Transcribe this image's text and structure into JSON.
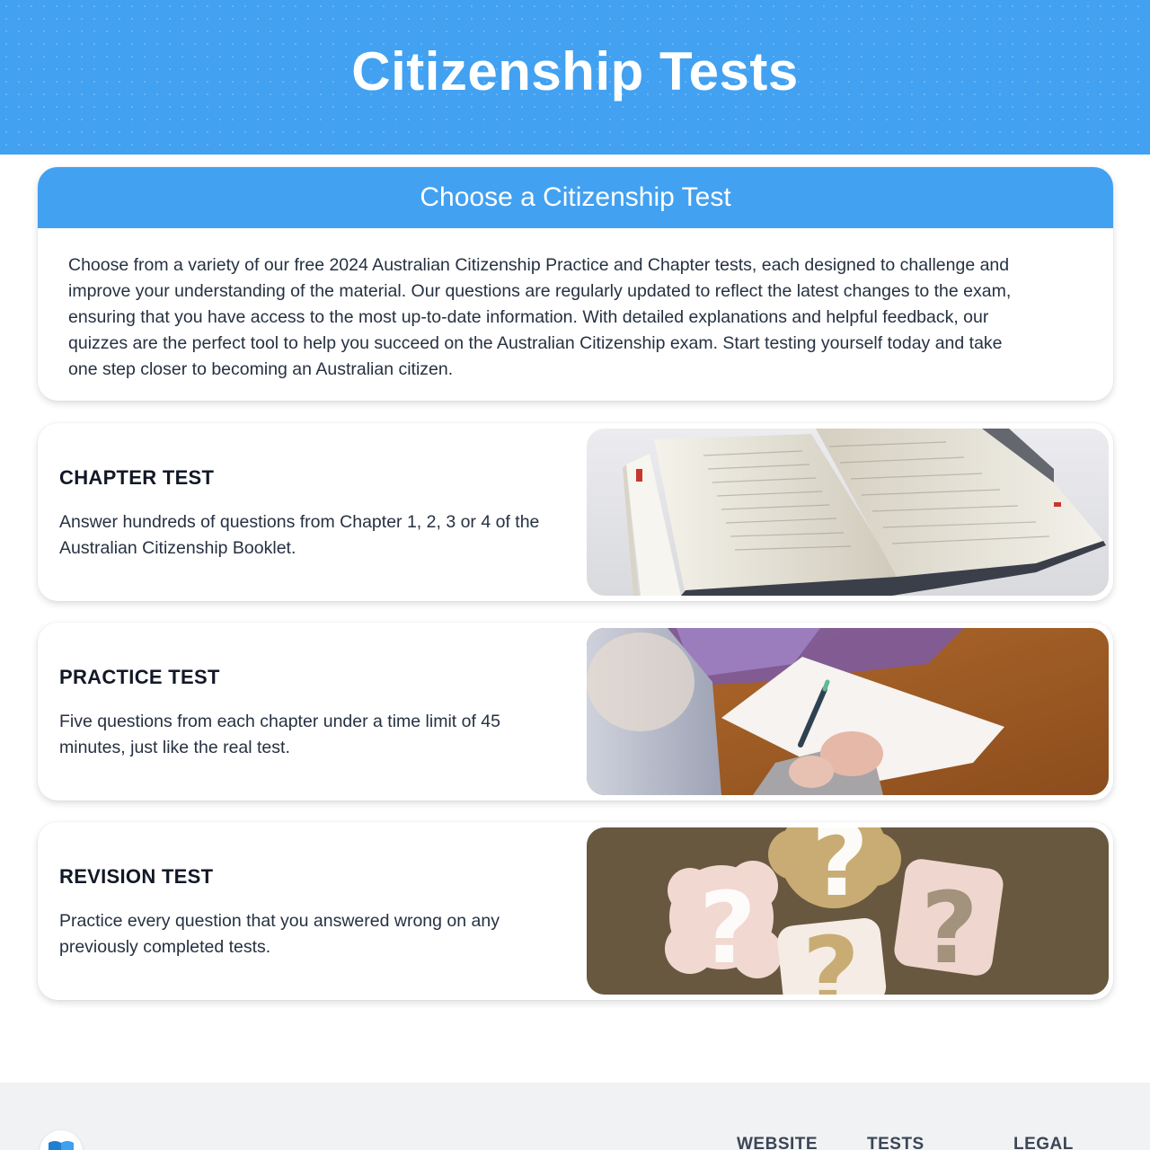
{
  "header": {
    "title": "Citizenship Tests"
  },
  "intro": {
    "heading": "Choose a Citizenship Test",
    "lines": [
      "Choose from a variety of our free 2024 Australian Citizenship Practice and Chapter tests, each designed to challenge and",
      "improve your understanding of the material. Our questions are regularly updated to reflect the latest changes to the exam,",
      "ensuring that you have access to the most up-to-date information. With detailed explanations and helpful feedback, our",
      "quizzes are the perfect tool to help you succeed on the Australian Citizenship exam. Start testing yourself today and take",
      "one step closer to becoming an Australian citizen."
    ]
  },
  "tests": [
    {
      "title": "CHAPTER TEST",
      "desc_lines": [
        "Answer hundreds of questions from Chapter 1, 2, 3 or 4 of the",
        "Australian Citizenship Booklet."
      ],
      "image": "open-book-photo"
    },
    {
      "title": "PRACTICE TEST",
      "desc_lines": [
        "Five questions from each chapter under a time limit of 45",
        "minutes, just like the real test."
      ],
      "image": "writing-on-paper-photo"
    },
    {
      "title": "REVISION TEST",
      "desc_lines": [
        "Practice every question that you answered wrong on any",
        "previously completed tests."
      ],
      "image": "question-marks-photo"
    }
  ],
  "footer": {
    "logo_icon": "book-icon",
    "columns": [
      "WEBSITE",
      "TESTS",
      "LEGAL"
    ]
  },
  "colors": {
    "brand_blue": "#42a1f1",
    "footer_bg": "#f1f2f4"
  }
}
